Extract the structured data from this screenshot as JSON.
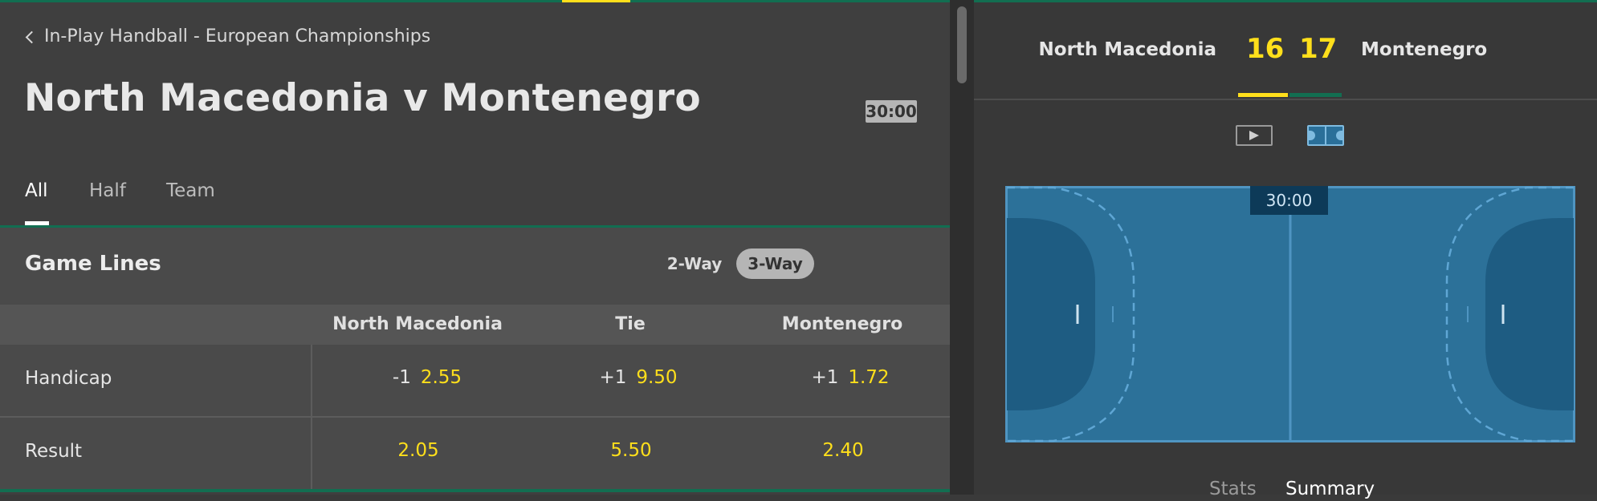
{
  "breadcrumb": {
    "label": "In-Play Handball - European Championships"
  },
  "match": {
    "title": "North Macedonia v Montenegro",
    "clock": "30:00"
  },
  "tabs": [
    {
      "label": "All",
      "active": true
    },
    {
      "label": "Half",
      "active": false
    },
    {
      "label": "Team",
      "active": false
    }
  ],
  "game_lines": {
    "title": "Game Lines",
    "way_options": [
      {
        "label": "2-Way",
        "selected": false
      },
      {
        "label": "3-Way",
        "selected": true
      }
    ],
    "columns": [
      "North Macedonia",
      "Tie",
      "Montenegro"
    ],
    "rows": [
      {
        "label": "Handicap",
        "cells": [
          {
            "line": "-1",
            "odds": "2.55"
          },
          {
            "line": "+1",
            "odds": "9.50"
          },
          {
            "line": "+1",
            "odds": "1.72"
          }
        ]
      },
      {
        "label": "Result",
        "cells": [
          {
            "line": "",
            "odds": "2.05"
          },
          {
            "line": "",
            "odds": "5.50"
          },
          {
            "line": "",
            "odds": "2.40"
          }
        ]
      }
    ]
  },
  "scoreboard": {
    "home_team": "North Macedonia",
    "away_team": "Montenegro",
    "home_score": "16",
    "away_score": "17",
    "home_color": "#ffdf1b",
    "away_color": "#126e51"
  },
  "view_icons": [
    {
      "name": "video-icon",
      "selected": false
    },
    {
      "name": "court-icon",
      "selected": true
    }
  ],
  "court": {
    "clock": "30:00"
  },
  "info_tabs": [
    {
      "label": "Stats",
      "active": false
    },
    {
      "label": "Summary",
      "active": true
    }
  ],
  "colors": {
    "accent_yellow": "#ffdf1b",
    "brand_green": "#126e51",
    "court_blue": "#2c7199"
  }
}
